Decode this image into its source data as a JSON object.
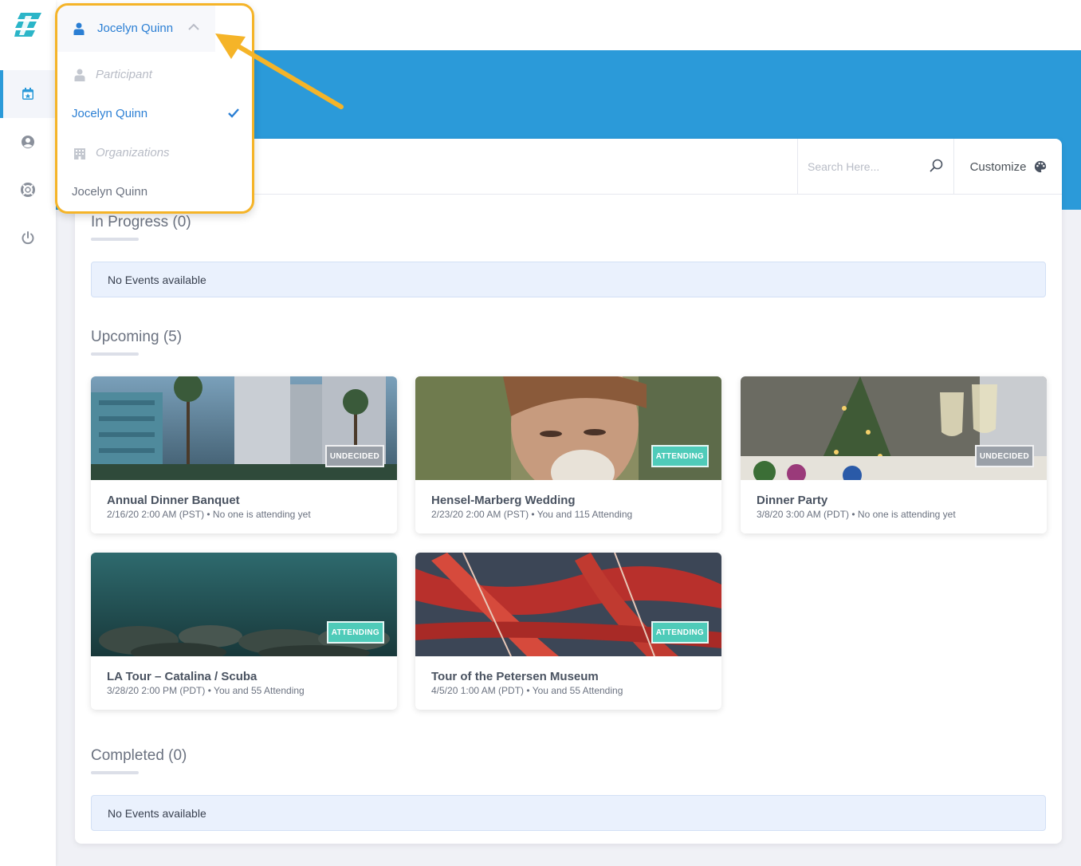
{
  "user": {
    "name": "Jocelyn Quinn"
  },
  "dropdown": {
    "participant_header": "Participant",
    "participant_item": "Jocelyn Quinn",
    "organizations_header": "Organizations",
    "organization_item": "Jocelyn Quinn"
  },
  "search": {
    "placeholder": "Search Here..."
  },
  "customize_label": "Customize",
  "sections": {
    "in_progress": {
      "title": "In Progress (0)",
      "empty": "No Events available"
    },
    "upcoming": {
      "title": "Upcoming (5)"
    },
    "completed": {
      "title": "Completed (0)",
      "empty": "No Events available"
    }
  },
  "events": [
    {
      "title": "Annual Dinner Banquet",
      "sub": "2/16/20 2:00 AM (PST) • No one is attending yet",
      "status": "UNDECIDED"
    },
    {
      "title": "Hensel-Marberg Wedding",
      "sub": "2/23/20 2:00 AM (PST) • You and 115 Attending",
      "status": "ATTENDING"
    },
    {
      "title": "Dinner Party",
      "sub": "3/8/20 3:00 AM (PDT) • No one is attending yet",
      "status": "UNDECIDED"
    },
    {
      "title": "LA Tour – Catalina / Scuba",
      "sub": "3/28/20 2:00 PM (PDT) • You and 55 Attending",
      "status": "ATTENDING"
    },
    {
      "title": "Tour of the Petersen Museum",
      "sub": "4/5/20 1:00 AM (PDT) • You and 55 Attending",
      "status": "ATTENDING"
    }
  ],
  "colors": {
    "brand": "#2b9ad9",
    "highlight": "#f5b428",
    "attending": "#4fcbb9",
    "undecided": "#9aa0a8"
  }
}
